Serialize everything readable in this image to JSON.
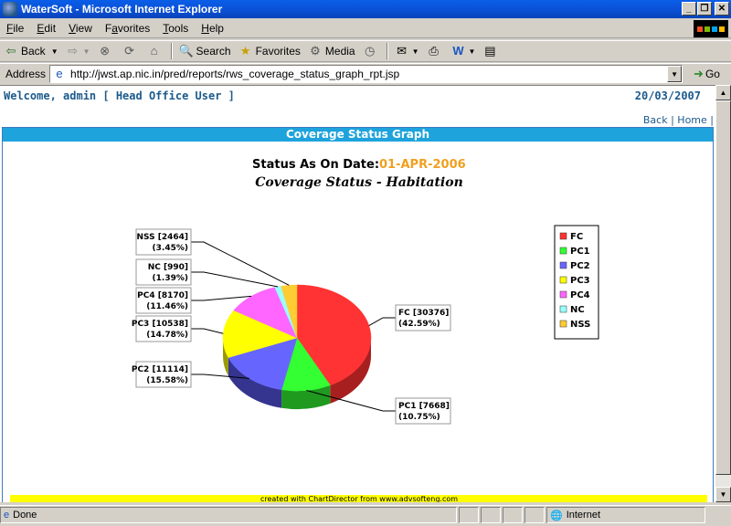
{
  "window": {
    "title": "WaterSoft - Microsoft Internet Explorer"
  },
  "menu": [
    {
      "label": "File",
      "key": "F",
      "rest": "ile"
    },
    {
      "label": "Edit",
      "key": "E",
      "rest": "dit"
    },
    {
      "label": "View",
      "key": "V",
      "rest": "iew"
    },
    {
      "label": "Favorites",
      "key": "a",
      "pre": "F",
      "rest": "vorites"
    },
    {
      "label": "Tools",
      "key": "T",
      "rest": "ools"
    },
    {
      "label": "Help",
      "key": "H",
      "rest": "elp"
    }
  ],
  "toolbar": {
    "back_label": "Back",
    "search_label": "Search",
    "favorites_label": "Favorites",
    "media_label": "Media"
  },
  "address": {
    "label": "Address",
    "url": "http://jwst.ap.nic.in/pred/reports/rws_coverage_status_graph_rpt.jsp",
    "go_label": "Go"
  },
  "page": {
    "welcome": "Welcome, admin [ Head Office User ]",
    "date": "20/03/2007",
    "back_link": "Back",
    "home_link": "Home",
    "link_sep": "|",
    "report_title": "Coverage Status Graph",
    "credit": "created with ChartDirector from www.advsofteng.com"
  },
  "chart_data": {
    "type": "pie",
    "status_label": "Status As On Date:",
    "status_date": "01-APR-2006",
    "title": "Coverage Status - Habitation",
    "slices": [
      {
        "name": "FC",
        "value": 30376,
        "percent": "42.59%",
        "color": "#ff3333",
        "dark": "#a81f1f"
      },
      {
        "name": "PC1",
        "value": 7668,
        "percent": "10.75%",
        "color": "#33ff33",
        "dark": "#1f9a1f"
      },
      {
        "name": "PC2",
        "value": 11114,
        "percent": "15.58%",
        "color": "#6666ff",
        "dark": "#35358f"
      },
      {
        "name": "PC3",
        "value": 10538,
        "percent": "14.78%",
        "color": "#ffff00",
        "dark": "#9a9a00"
      },
      {
        "name": "PC4",
        "value": 8170,
        "percent": "11.46%",
        "color": "#ff66ff",
        "dark": "#9a3a9a"
      },
      {
        "name": "NC",
        "value": 990,
        "percent": "1.39%",
        "color": "#99ffff",
        "dark": "#5a9a9a"
      },
      {
        "name": "NSS",
        "value": 2464,
        "percent": "3.45%",
        "color": "#ffcc33",
        "dark": "#9a7a1f"
      }
    ],
    "legend": [
      "FC",
      "PC1",
      "PC2",
      "PC3",
      "PC4",
      "NC",
      "NSS"
    ],
    "legend_position": "right"
  },
  "status": {
    "left": "Done",
    "zone": "Internet"
  },
  "colors": {
    "header_bar": "#1ea3dc",
    "welcome_text": "#1c5a8c",
    "date_highlight": "#f0a020",
    "credit_bar": "#ffff00"
  }
}
